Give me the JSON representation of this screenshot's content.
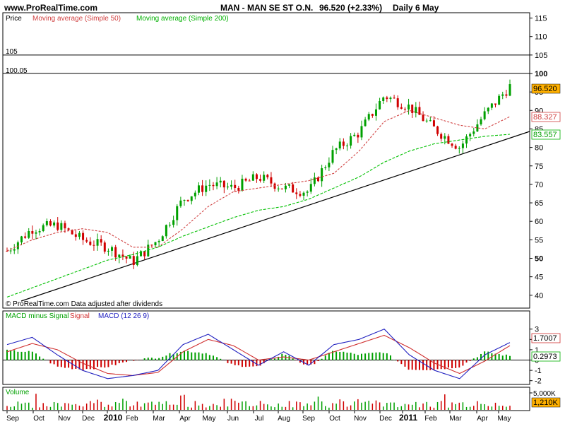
{
  "header": {
    "site": "www.ProRealTime.com",
    "instrument": "MAN - MAN SE ST O.N.",
    "last": "96.520 (+2.33%)",
    "period": "Daily  6 May"
  },
  "price_panel": {
    "label": "Price",
    "ma50_label": "Moving average (Simple 50)",
    "ma200_label": "Moving average (Simple 200)",
    "hline_labels": [
      "105",
      "100.05"
    ],
    "copyright": "© ProRealTime.com  Data adjusted after dividends",
    "y_ticks": [
      "115",
      "110",
      "105",
      "100",
      "95",
      "90",
      "85",
      "80",
      "75",
      "70",
      "65",
      "60",
      "55",
      "50",
      "45",
      "40"
    ],
    "bold_ticks": [
      "100",
      "50"
    ],
    "badges": {
      "last": "96.520",
      "ma50": "88.327",
      "ma200": "83.557"
    }
  },
  "macd_panel": {
    "label_hist": "MACD minus Signal",
    "label_signal": "Signal",
    "label_macd": "MACD (12 26 9)",
    "y_ticks": [
      "3",
      "2",
      "1",
      "0",
      "-1",
      "-2"
    ],
    "badges": {
      "macd": "1.7007",
      "diff": "0.2973"
    }
  },
  "volume_panel": {
    "label": "Volume",
    "y_ticks": [
      "5,000K"
    ],
    "badge": "1,210K"
  },
  "x_axis": {
    "labels": [
      "Sep",
      "Oct",
      "Nov",
      "Dec",
      "2010",
      "Feb",
      "Mar",
      "Apr",
      "May",
      "Jun",
      "Jul",
      "Aug",
      "Sep",
      "Oct",
      "Nov",
      "Dec",
      "2011",
      "Feb",
      "Mar",
      "Apr",
      "May"
    ],
    "bold": [
      "2010",
      "2011"
    ]
  },
  "colors": {
    "up": "#00a000",
    "down": "#d00000",
    "ma50": "#d04040",
    "ma200": "#00c000",
    "signal": "#d03030",
    "macd": "#2020c0",
    "badge_last": "#ffb000"
  },
  "chart_data": {
    "type": "line",
    "title": "MAN - MAN SE ST O.N.",
    "ylim": [
      38,
      118
    ],
    "x": [
      "Sep",
      "Oct",
      "Nov",
      "Dec",
      "2010",
      "Feb",
      "Mar",
      "Apr",
      "May",
      "Jun",
      "Jul",
      "Aug",
      "Sep",
      "Oct",
      "Nov",
      "Dec",
      "2011",
      "Feb",
      "Mar",
      "Apr",
      "May"
    ],
    "series": [
      {
        "name": "Price",
        "values": [
          52,
          58,
          59,
          55,
          53,
          49,
          55,
          66,
          70,
          69,
          72,
          69,
          68,
          79,
          84,
          94,
          91,
          85,
          80,
          89,
          96.52
        ]
      },
      {
        "name": "Moving average (Simple 50)",
        "values": [
          52,
          55,
          57,
          58,
          57,
          53,
          53,
          58,
          64,
          68,
          69,
          70,
          71,
          73,
          79,
          87,
          90,
          88,
          86,
          85,
          88.33
        ]
      },
      {
        "name": "Moving average (Simple 200)",
        "values": [
          39.5,
          42,
          44.5,
          47,
          49.5,
          51,
          53,
          56,
          58.5,
          61,
          63,
          64,
          66,
          69,
          72,
          76,
          79,
          81,
          82,
          83,
          83.56
        ]
      }
    ],
    "macd": {
      "name": "MACD (12 26 9)",
      "macd": [
        1.5,
        2.2,
        0.5,
        -1.0,
        -1.8,
        -1.5,
        -1.0,
        1.5,
        2.5,
        1.0,
        -0.5,
        0.8,
        -0.5,
        1.5,
        2.0,
        3.0,
        0.5,
        -1.0,
        -1.8,
        0.5,
        1.7
      ],
      "signal": [
        0.8,
        1.6,
        1.0,
        -0.3,
        -1.3,
        -1.5,
        -1.2,
        0.8,
        2.0,
        1.4,
        0.0,
        0.3,
        0.0,
        0.8,
        1.6,
        2.4,
        1.2,
        -0.3,
        -1.3,
        -0.1,
        1.4
      ]
    },
    "volume_axis_max": "5,000K",
    "last_volume": "1,210K"
  }
}
